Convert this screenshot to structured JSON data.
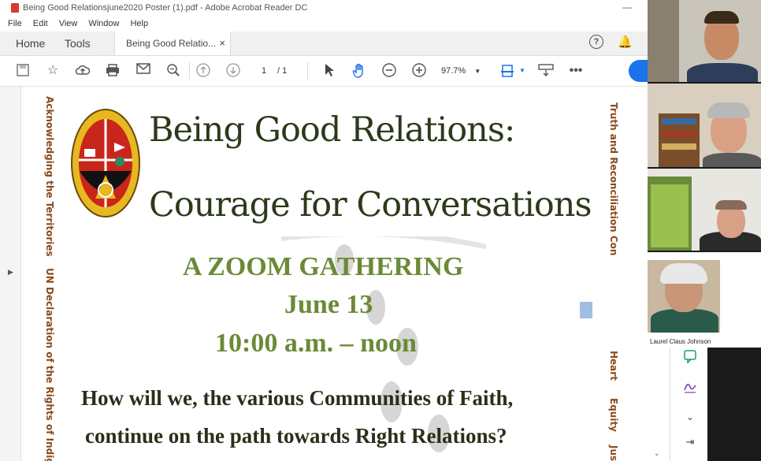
{
  "window": {
    "title": "Being Good Relationsjune2020 Poster (1).pdf - Adobe Acrobat Reader DC"
  },
  "menu": [
    "File",
    "Edit",
    "View",
    "Window",
    "Help"
  ],
  "tabs": {
    "home": "Home",
    "tools": "Tools",
    "doc": "Being Good Relatio...",
    "close": "×"
  },
  "toolbar": {
    "page_current": "1",
    "page_total": "/ 1",
    "zoom": "97.7%"
  },
  "poster": {
    "title_line1": "Being Good Relations:",
    "title_line2": "Courage for Conversations",
    "gathering": "A ZOOM GATHERING",
    "date": "June 13",
    "time": "10:00 a.m. – noon",
    "question_line1": "How will we, the various Communities of Faith,",
    "question_line2": "continue on the path towards Right Relations?",
    "left_vertical_1": "Acknowledging the Territories",
    "left_vertical_2": "UN Declaration of the Rights of Indige",
    "right_vertical_1": "Truth and Reconciliation Con",
    "right_vertical_2": "Heart",
    "right_vertical_3": "Equity",
    "right_vertical_4": "Jus"
  },
  "participants": {
    "highlighted_name": "Laurel Claus Johnson"
  },
  "colors": {
    "accent_blue": "#1a73e8",
    "poster_green": "#6b8a36",
    "poster_brown": "#8a4a1c"
  }
}
